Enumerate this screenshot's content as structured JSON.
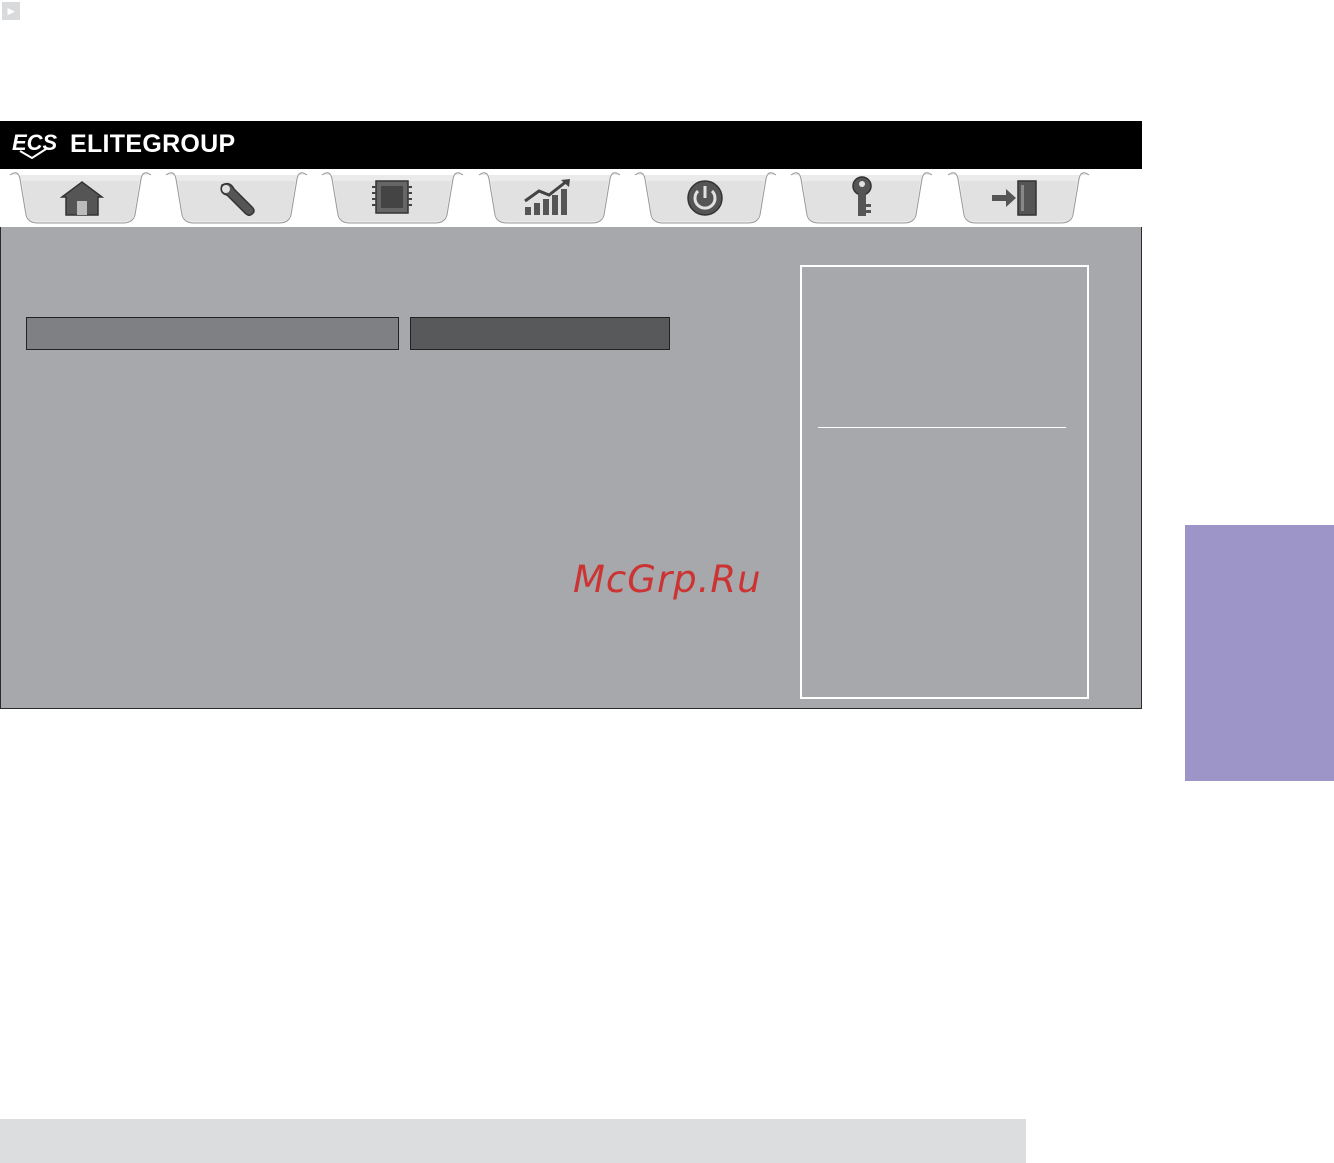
{
  "header": {
    "logo_mark": "ECS",
    "brand": "ELITEGROUP"
  },
  "tabs": [
    {
      "icon": "home-icon"
    },
    {
      "icon": "wrench-icon"
    },
    {
      "icon": "chip-icon"
    },
    {
      "icon": "performance-chart-icon"
    },
    {
      "icon": "power-icon"
    },
    {
      "icon": "key-icon"
    },
    {
      "icon": "exit-icon"
    }
  ],
  "watermark": "McGrp.Ru",
  "colors": {
    "header_bg": "#000000",
    "content_bg": "#a7a8ab",
    "side_tab": "#9d95c8",
    "footer_bar": "#dcdddf",
    "watermark": "#cc3333"
  }
}
